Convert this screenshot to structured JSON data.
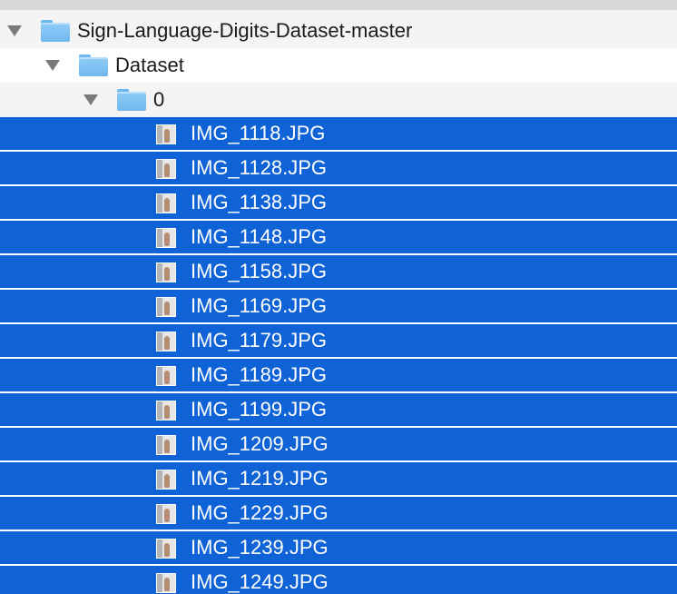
{
  "tree": {
    "root": {
      "name": "Sign-Language-Digits-Dataset-master",
      "icon": "folder-icon",
      "expanded": true
    },
    "dataset": {
      "name": "Dataset",
      "icon": "folder-icon",
      "expanded": true
    },
    "folder0": {
      "name": "0",
      "icon": "folder-icon",
      "expanded": true
    },
    "files": [
      "IMG_1118.JPG",
      "IMG_1128.JPG",
      "IMG_1138.JPG",
      "IMG_1148.JPG",
      "IMG_1158.JPG",
      "IMG_1169.JPG",
      "IMG_1179.JPG",
      "IMG_1189.JPG",
      "IMG_1199.JPG",
      "IMG_1209.JPG",
      "IMG_1219.JPG",
      "IMG_1229.JPG",
      "IMG_1239.JPG",
      "IMG_1249.JPG"
    ],
    "file_icon": "image-thumbnail-icon"
  },
  "colors": {
    "selection": "#0f63d6",
    "folder": "#7ec3f3",
    "stripe": "#f4f4f4"
  }
}
